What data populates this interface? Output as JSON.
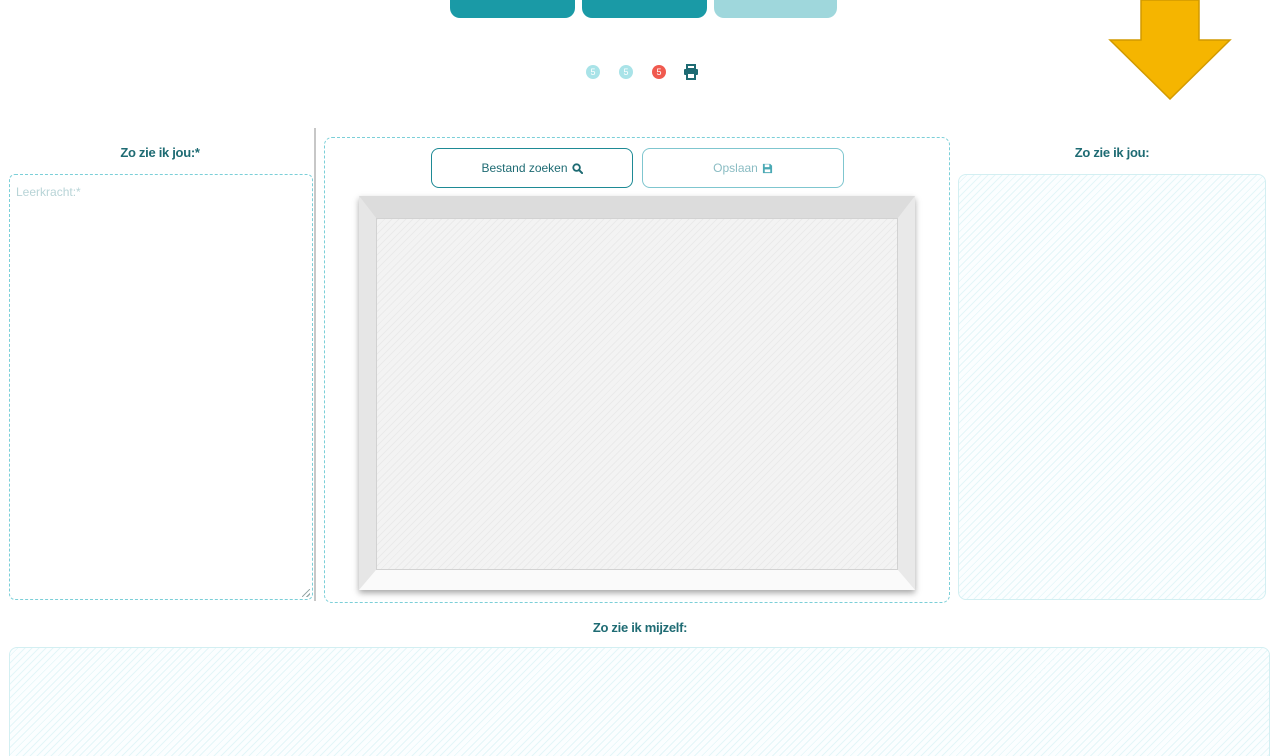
{
  "top_tabs": [
    "",
    "",
    ""
  ],
  "indicators": [
    {
      "label": "5",
      "color": "#a9e3e8"
    },
    {
      "label": "5",
      "color": "#a9e3e8"
    },
    {
      "label": "5",
      "color": "#f05a4f"
    }
  ],
  "print_icon": "print-icon",
  "arrow_color": "#f5b500",
  "left": {
    "title": "Zo zie ik jou:*",
    "placeholder": "Leerkracht:*"
  },
  "center": {
    "search_button": "Bestand zoeken",
    "search_icon": "search-icon",
    "save_button": "Opslaan",
    "save_icon": "floppy-disk-icon"
  },
  "right": {
    "title": "Zo zie ik jou:"
  },
  "bottom": {
    "title": "Zo zie ik mijzelf:"
  },
  "colors": {
    "accent": "#1a9aa6",
    "text": "#1e6b73",
    "dashed_border": "#7bcfd8",
    "badge_red": "#f05a4f"
  }
}
